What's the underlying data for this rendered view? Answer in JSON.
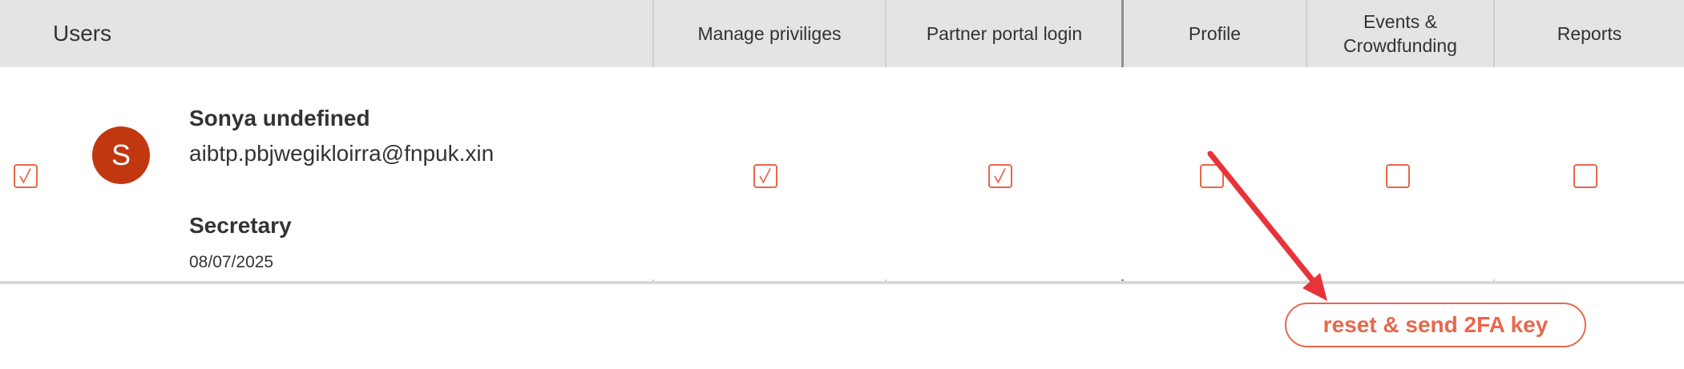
{
  "header": {
    "users": "Users",
    "manage_privileges": "Manage priviliges",
    "partner_portal_login": "Partner portal login",
    "profile": "Profile",
    "events_line1": "Events &",
    "events_line2": "Crowdfunding",
    "reports": "Reports"
  },
  "user": {
    "avatar_initial": "S",
    "name": "Sonya undefined",
    "email": "aibtp.pbjwegikloirra@fnpuk.xin",
    "role": "Secretary",
    "date": "08/07/2025",
    "selected": true,
    "permissions": {
      "manage_privileges": true,
      "partner_portal_login": true,
      "profile": false,
      "events_crowdfunding": false,
      "reports": false
    }
  },
  "actions": {
    "reset_2fa_label": "reset & send 2FA key"
  },
  "colors": {
    "accent": "#e8674c",
    "avatar_bg": "#c13710",
    "header_bg": "#e4e4e4",
    "annotation_arrow": "#e8333a"
  },
  "icons": {
    "checkbox_checked": "check-mark",
    "annotation": "red-arrow"
  }
}
